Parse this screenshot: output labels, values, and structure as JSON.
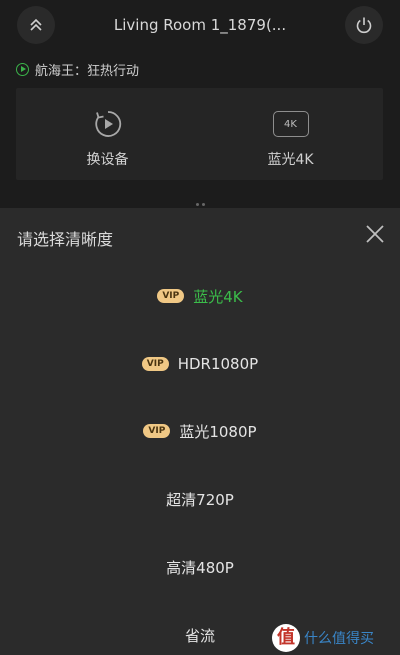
{
  "header": {
    "device_name": "Living Room 1_1879(...",
    "now_playing": "航海王：狂热行动"
  },
  "actions": [
    {
      "label": "换设备",
      "icon": "switch-device-icon"
    },
    {
      "label": "蓝光4K",
      "icon": "resolution-4k-icon",
      "badge": "4K"
    }
  ],
  "sheet": {
    "title": "请选择清晰度",
    "options": [
      {
        "label": "蓝光4K",
        "vip": "VIP",
        "selected": true
      },
      {
        "label": "HDR1080P",
        "vip": "VIP",
        "selected": false
      },
      {
        "label": "蓝光1080P",
        "vip": "VIP",
        "selected": false
      },
      {
        "label": "超清720P",
        "vip": "",
        "selected": false
      },
      {
        "label": "高清480P",
        "vip": "",
        "selected": false
      },
      {
        "label": "省流",
        "vip": "",
        "selected": false
      }
    ]
  },
  "watermark": {
    "logo": "值",
    "text": "什么值得买"
  },
  "colors": {
    "selected_accent": "#3bbd4a",
    "vip_badge": "#f0c885",
    "sheet_background": "#2b2b2b",
    "page_background": "#1c1c1c"
  }
}
